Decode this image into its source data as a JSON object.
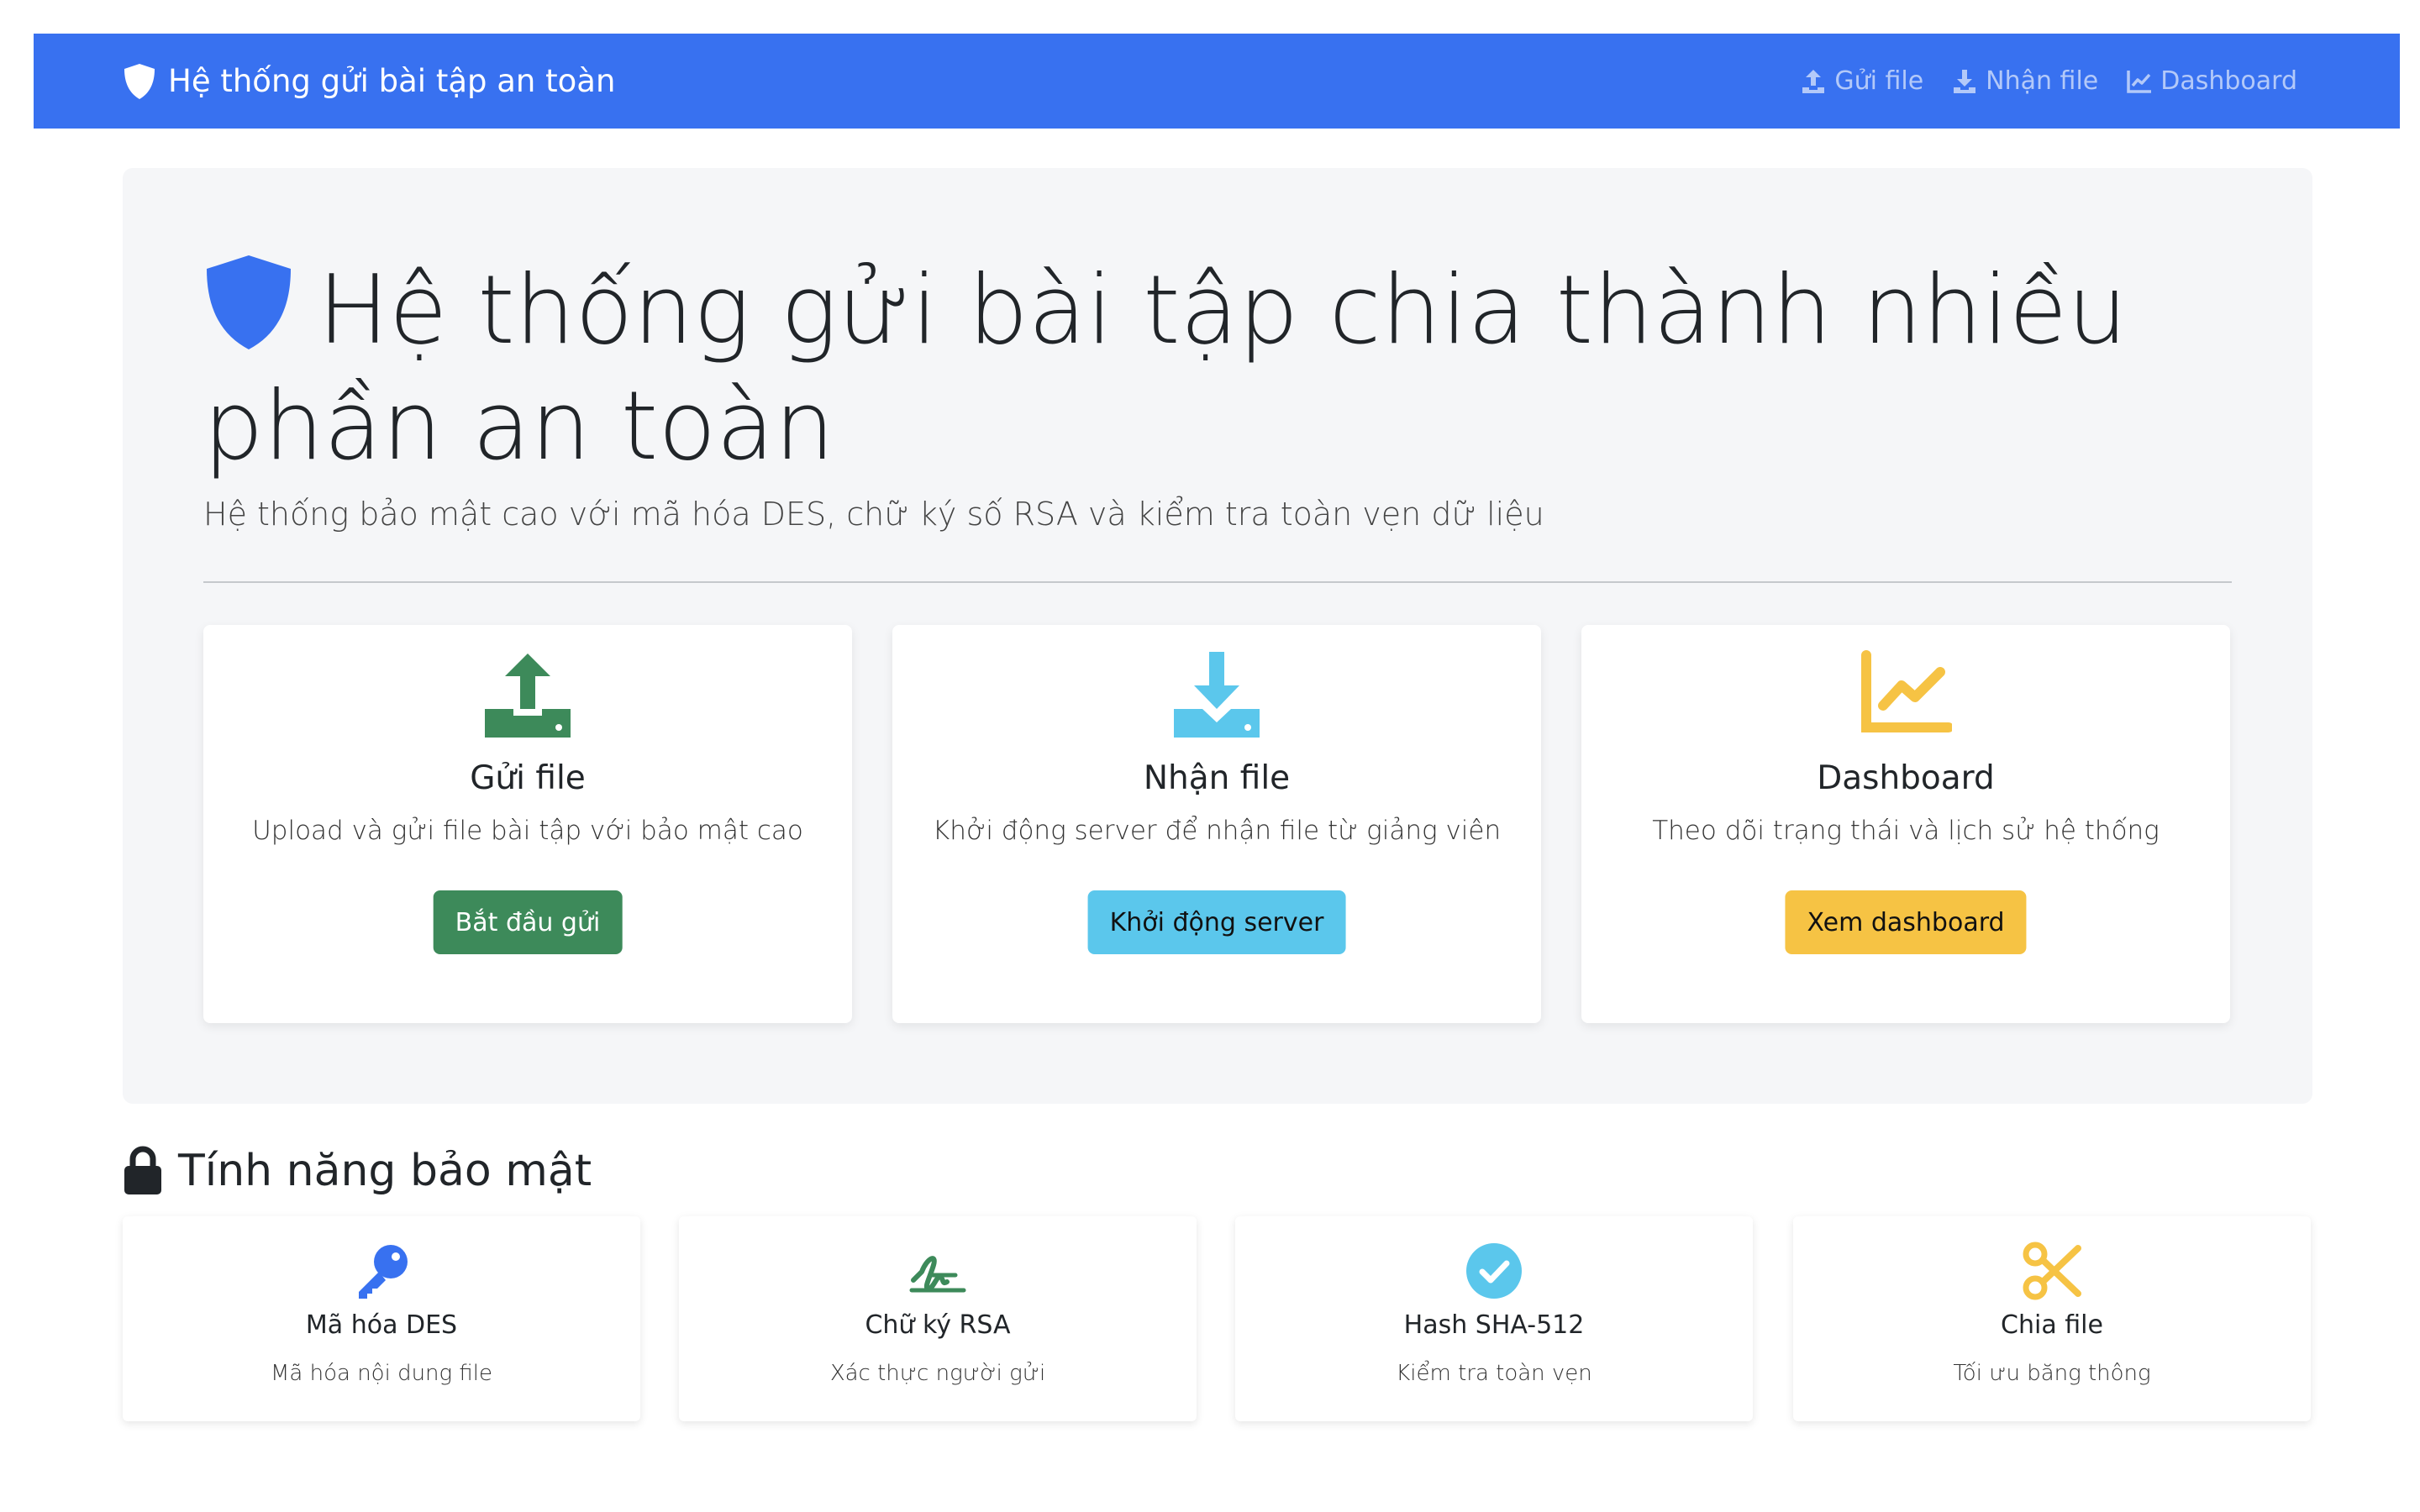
{
  "navbar": {
    "brand": "Hệ thống gửi bài tập an toàn",
    "links": [
      {
        "label": "Gửi file",
        "icon": "upload-icon"
      },
      {
        "label": "Nhận file",
        "icon": "download-icon"
      },
      {
        "label": "Dashboard",
        "icon": "chart-line-icon"
      }
    ]
  },
  "hero": {
    "title": "Hệ thống gửi bài tập chia thành nhiều phần an toàn",
    "subtitle": "Hệ thống bảo mật cao với mã hóa DES, chữ ký số RSA và kiểm tra toàn vẹn dữ liệu"
  },
  "cards": [
    {
      "title": "Gửi file",
      "text": "Upload và gửi file bài tập với bảo mật cao",
      "button": "Bắt đầu gửi",
      "icon": "upload-icon",
      "color": "#3d8a5a"
    },
    {
      "title": "Nhận file",
      "text": "Khởi động server để nhận file từ giảng viên",
      "button": "Khởi động server",
      "icon": "download-icon",
      "color": "#5bc7ec"
    },
    {
      "title": "Dashboard",
      "text": "Theo dõi trạng thái và lịch sử hệ thống",
      "button": "Xem dashboard",
      "icon": "chart-line-icon",
      "color": "#f6c344"
    }
  ],
  "security": {
    "title": "Tính năng bảo mật",
    "features": [
      {
        "title": "Mã hóa DES",
        "text": "Mã hóa nội dung file",
        "icon": "key-icon",
        "color": "#3871f0"
      },
      {
        "title": "Chữ ký RSA",
        "text": "Xác thực người gửi",
        "icon": "signature-icon",
        "color": "#3d8a5a"
      },
      {
        "title": "Hash SHA-512",
        "text": "Kiểm tra toàn vẹn",
        "icon": "check-circle-icon",
        "color": "#5bc7ec"
      },
      {
        "title": "Chia file",
        "text": "Tối ưu băng thông",
        "icon": "scissors-icon",
        "color": "#f6c344"
      }
    ]
  },
  "colors": {
    "primary": "#3871f0",
    "success": "#3d8a5a",
    "info": "#5bc7ec",
    "warning": "#f6c344"
  }
}
